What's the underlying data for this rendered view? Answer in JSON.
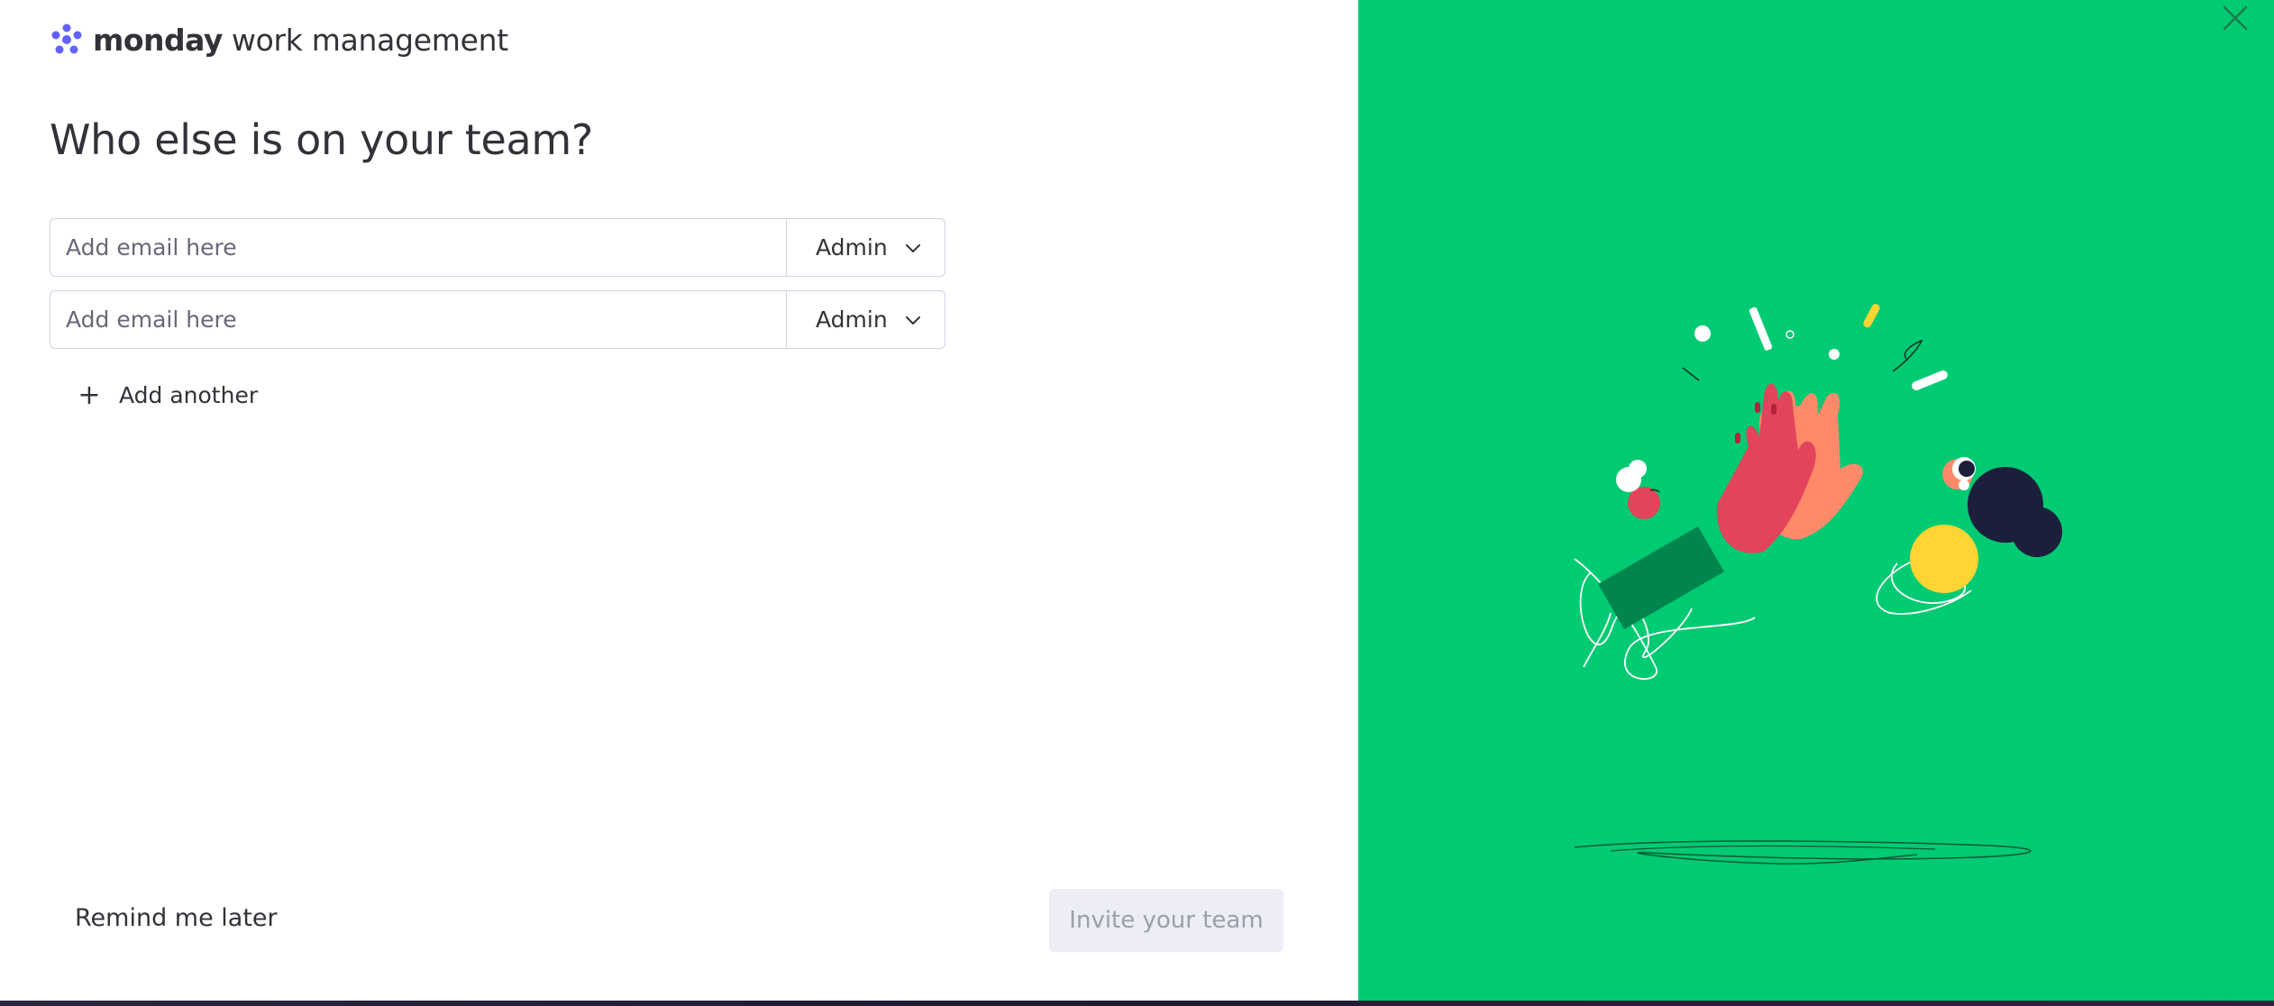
{
  "brand": {
    "name": "monday",
    "product": "work management",
    "logo_icon": "monday-dots-icon"
  },
  "title": "Who else is on your team?",
  "invites": [
    {
      "email": "",
      "placeholder": "Add email here",
      "role": "Admin"
    },
    {
      "email": "",
      "placeholder": "Add email here",
      "role": "Admin"
    }
  ],
  "add_another": {
    "label": "Add another",
    "icon": "plus-icon"
  },
  "footer": {
    "remind_label": "Remind me later",
    "invite_label": "Invite your team",
    "invite_enabled": false
  },
  "close_icon": "close-icon",
  "colors": {
    "accent_green": "#00ca72",
    "text": "#323338",
    "border": "#d0d4e4",
    "disabled_bg": "#ecedf5",
    "disabled_text": "#9c9eab"
  }
}
